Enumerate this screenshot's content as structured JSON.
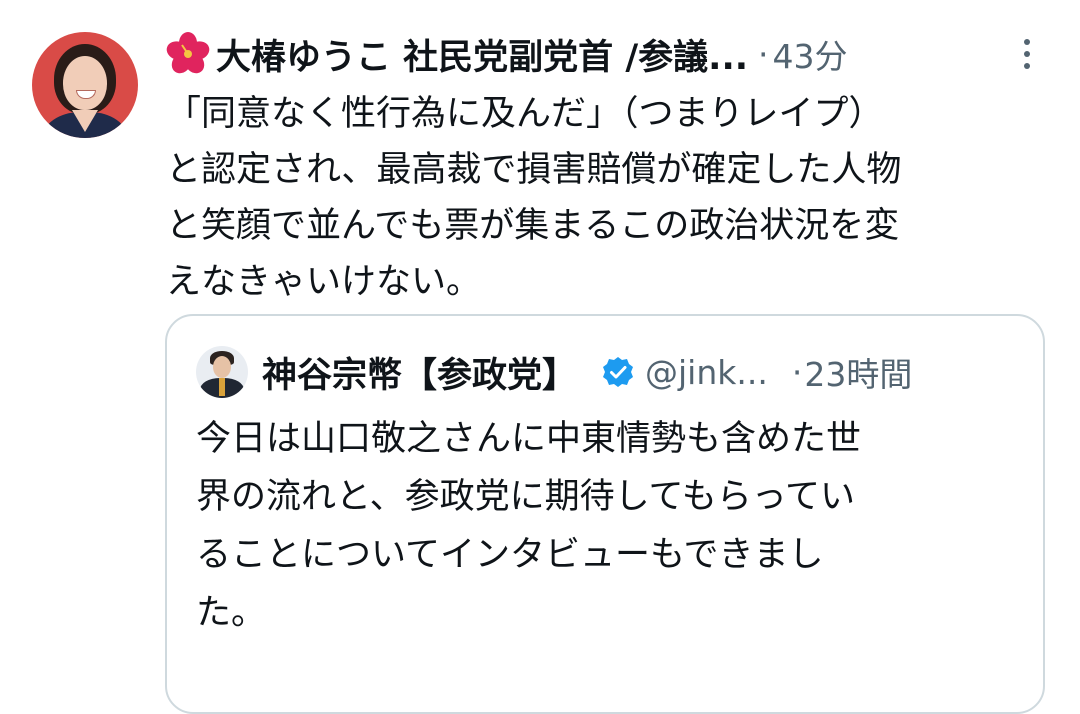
{
  "tweet": {
    "author_display_name": "大椿ゆうこ 社民党副党首 /参議...",
    "author_name_emoji_icon": "hibiscus-icon",
    "separator": "·",
    "timestamp": "43分",
    "more_icon": "more-vertical-icon",
    "text": "「同意なく性行為に及んだ」（つまりレイプ）\nと認定され、最高裁で損害賠償が確定した人物\nと笑顔で並んでも票が集まるこの政治状況を変\nえなきゃいけない。"
  },
  "quoted_tweet": {
    "author_display_name": "神谷宗幣【参政党】",
    "verified_icon": "verified-badge-icon",
    "handle": "@jink...",
    "separator": "·",
    "timestamp": "23時間",
    "text": "今日は山口敬之さんに中東情勢も含めた世\n界の流れと、参政党に期待してもらってい\nることについてインタビューもできまし\nた。"
  },
  "colors": {
    "text_primary": "#0f1419",
    "text_secondary": "#536471",
    "verified_blue": "#1d9bf0",
    "card_border": "#cfd9de",
    "avatar_bg": "#d94b47"
  }
}
